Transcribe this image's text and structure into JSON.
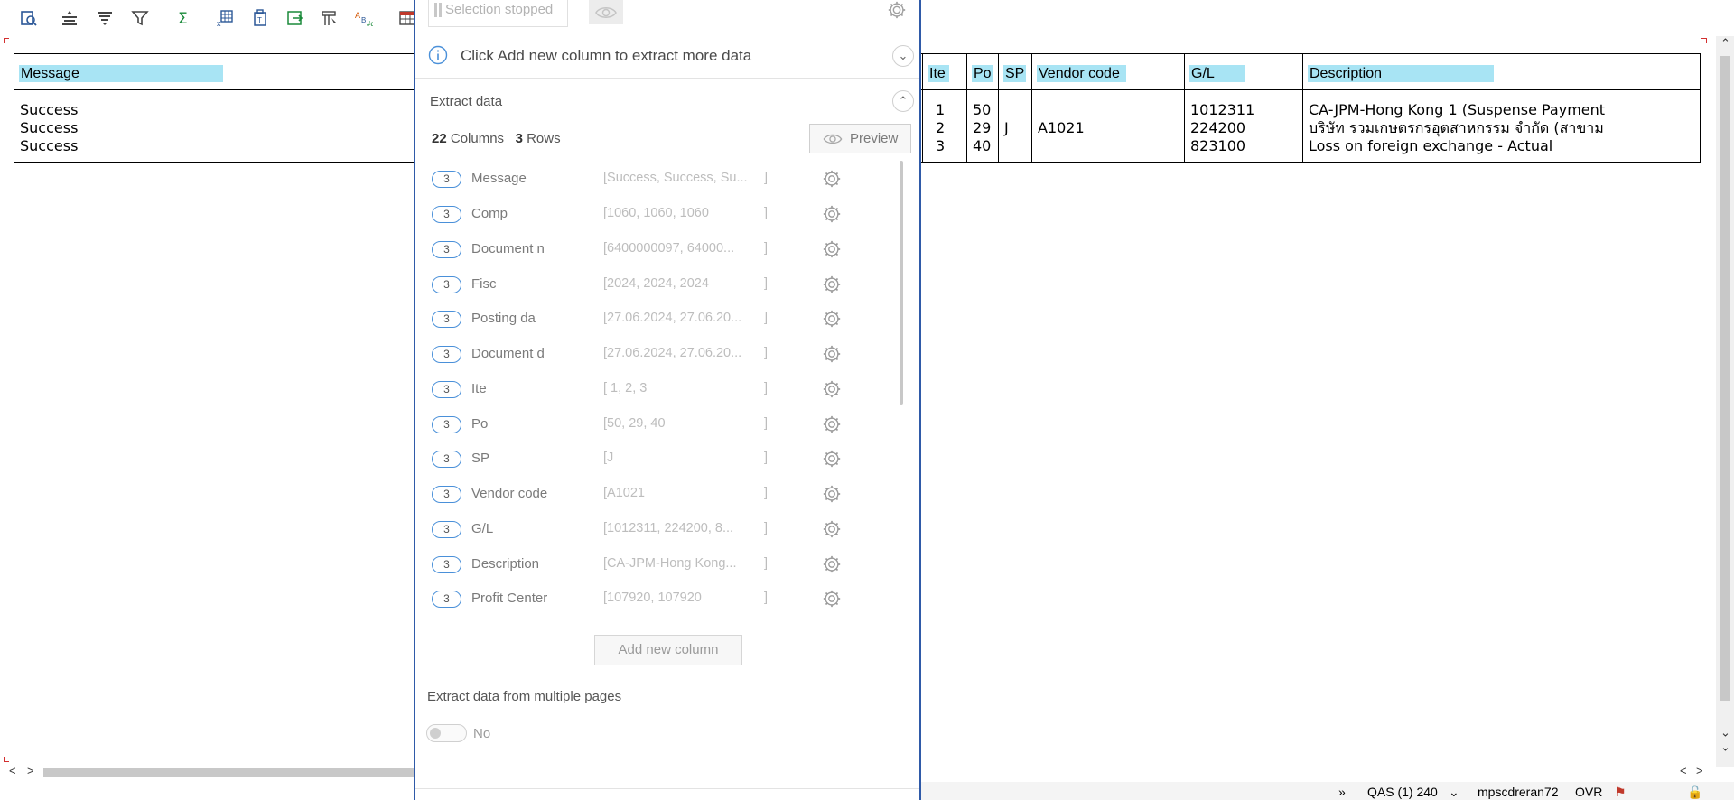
{
  "toolbar": {
    "buttons": [
      {
        "name": "details-icon",
        "color": "#2b5797"
      },
      {
        "name": "sort-ascending-icon",
        "color": "#444444"
      },
      {
        "name": "sort-descending-icon",
        "color": "#444444"
      },
      {
        "name": "filter-icon",
        "color": "#444444"
      },
      {
        "name": "sum-icon",
        "color": "#1a8a3a"
      },
      {
        "name": "subtotal-icon",
        "color": "#2b5797"
      },
      {
        "name": "print-preview-icon",
        "color": "#2b5797"
      },
      {
        "name": "export-icon",
        "color": "#1a8a3a"
      },
      {
        "name": "layout-icon",
        "color": "#444444"
      },
      {
        "name": "spell-check-icon",
        "color": "#d35400"
      },
      {
        "name": "table-icon",
        "color": "#c0392b"
      }
    ]
  },
  "grid": {
    "columns": [
      {
        "key": "message",
        "header": "Message"
      },
      {
        "key": "item",
        "header": "Ite"
      },
      {
        "key": "po",
        "header": "Po"
      },
      {
        "key": "sp",
        "header": "SP"
      },
      {
        "key": "vendor",
        "header": "Vendor code"
      },
      {
        "key": "gl",
        "header": "G/L"
      },
      {
        "key": "description",
        "header": "Description"
      }
    ],
    "rows": [
      {
        "message": "Success",
        "item": "1",
        "po": "50",
        "sp": "",
        "vendor": "",
        "gl": "1012311",
        "description": "CA-JPM-Hong Kong 1 (Suspense Payment"
      },
      {
        "message": "Success",
        "item": "2",
        "po": "29",
        "sp": "J",
        "vendor": "A1021",
        "gl": "224200",
        "description": "บริษัท รวมเกษตรกรอุตสาหกรรม จำกัด (สาขาม"
      },
      {
        "message": "Success",
        "item": "3",
        "po": "40",
        "sp": "",
        "vendor": "",
        "gl": "823100",
        "description": "Loss on foreign exchange - Actual"
      }
    ]
  },
  "panel": {
    "selection_status": "Selection stopped",
    "info_text": "Click Add new column to extract more data",
    "section_title": "Extract data",
    "columns_count": "22",
    "columns_label": "Columns",
    "rows_count": "3",
    "rows_label": "Rows",
    "preview_label": "Preview",
    "items": [
      {
        "count": "3",
        "name": "Message",
        "value": "[Success, Success, Su...",
        "close": "]"
      },
      {
        "count": "3",
        "name": "Comp",
        "value": "[1060, 1060, 1060",
        "close": "]"
      },
      {
        "count": "3",
        "name": "Document n",
        "value": "[6400000097, 64000...",
        "close": "]"
      },
      {
        "count": "3",
        "name": "Fisc",
        "value": "[2024, 2024, 2024",
        "close": "]"
      },
      {
        "count": "3",
        "name": "Posting da",
        "value": "[27.06.2024, 27.06.20...",
        "close": "]"
      },
      {
        "count": "3",
        "name": "Document d",
        "value": "[27.06.2024, 27.06.20...",
        "close": "]"
      },
      {
        "count": "3",
        "name": "Ite",
        "value": "[ 1,  2,  3",
        "close": "]"
      },
      {
        "count": "3",
        "name": "Po",
        "value": "[50, 29, 40",
        "close": "]"
      },
      {
        "count": "3",
        "name": "SP",
        "value": "[J",
        "close": "]"
      },
      {
        "count": "3",
        "name": "Vendor code",
        "value": "[A1021",
        "close": "]"
      },
      {
        "count": "3",
        "name": "G/L",
        "value": "[1012311, 224200, 8...",
        "close": "]"
      },
      {
        "count": "3",
        "name": "Description",
        "value": "[CA-JPM-Hong Kong...",
        "close": "]"
      },
      {
        "count": "3",
        "name": "Profit Center",
        "value": "[107920, 107920",
        "close": "]"
      }
    ],
    "add_column_label": "Add new column",
    "multi_page_title": "Extract data from multiple pages",
    "multi_page_value": "No"
  },
  "statusbar": {
    "system": "QAS (1) 240",
    "server": "mpscdreran72",
    "mode": "OVR"
  },
  "colors": {
    "header_highlight": "#a8e4f4",
    "panel_border": "#2f5aa8",
    "badge_border": "#4a90d9"
  }
}
